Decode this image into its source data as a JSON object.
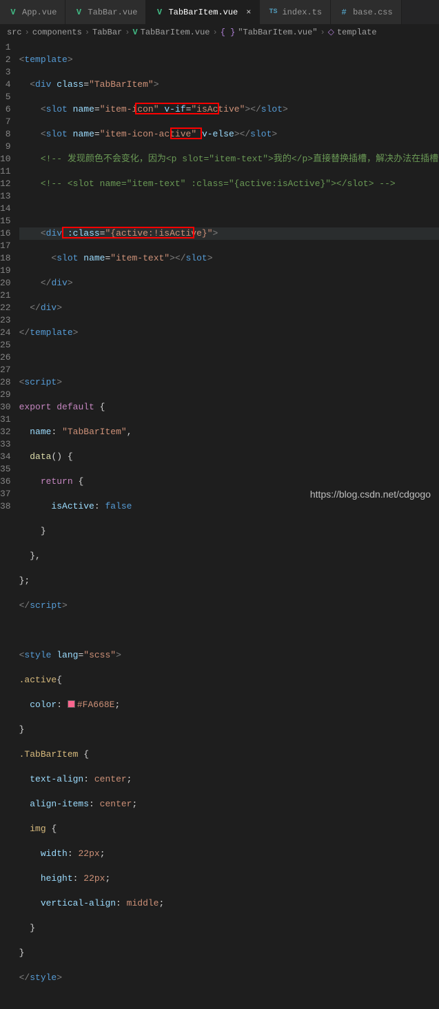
{
  "tabs": [
    {
      "label": "App.vue",
      "icon": "vue",
      "active": false
    },
    {
      "label": "TabBar.vue",
      "icon": "vue",
      "active": false
    },
    {
      "label": "TabBarItem.vue",
      "icon": "vue",
      "active": true
    },
    {
      "label": "index.ts",
      "icon": "ts",
      "active": false
    },
    {
      "label": "base.css",
      "icon": "css",
      "active": false
    }
  ],
  "breadcrumb": {
    "parts": [
      {
        "label": "src"
      },
      {
        "label": "components"
      },
      {
        "label": "TabBar"
      },
      {
        "label": "TabBarItem.vue",
        "icon": "vue"
      },
      {
        "label": "\"TabBarItem.vue\"",
        "icon": "braces"
      },
      {
        "label": "template",
        "icon": "cube"
      }
    ]
  },
  "lineNumbers": [
    "1",
    "2",
    "3",
    "4",
    "5",
    "6",
    "7",
    "8",
    "9",
    "10",
    "11",
    "12",
    "13",
    "14",
    "15",
    "16",
    "17",
    "18",
    "19",
    "20",
    "21",
    "22",
    "23",
    "24",
    "25",
    "26",
    "27",
    "28",
    "29",
    "30",
    "31",
    "32",
    "33",
    "34",
    "35",
    "36",
    "37",
    "38"
  ],
  "code": {
    "l1": "<template>",
    "l2": "  <div class=\"TabBarItem\">",
    "l3a": "    <slot name=\"item-icon\" ",
    "l3b": "v-if=\"isActive\"",
    "l3c": "></slot>",
    "l4a": "    <slot name=\"item-icon-active\" ",
    "l4b": "v-else",
    "l4c": "></slot>",
    "l5": "    <!-- 发现颜色不会变化，因为<p slot=\"item-text\">我的</p>直接替换插槽，解决办法在插槽外边",
    "l6": "    <!-- <slot name=\"item-text\" :class=\"{active:isActive}\"></slot> -->",
    "l7": "",
    "l8a": "    <div ",
    "l8b": ":class=\"{active:!isActive}\"",
    "l8c": ">",
    "l9": "      <slot name=\"item-text\"></slot>",
    "l10": "    </div>",
    "l11": "  </div>",
    "l12": "</template>",
    "l14": "<script>",
    "l15": "export default {",
    "l16": "  name: \"TabBarItem\",",
    "l17": "  data() {",
    "l18": "    return {",
    "l19": "      isActive: false",
    "l20": "    }",
    "l21": "  },",
    "l22": "};",
    "l23": "</script>",
    "l25": "<style lang=\"scss\">",
    "l26": ".active{",
    "l27": "  color: #FA668E;",
    "l28": "}",
    "l29": ".TabBarItem {",
    "l30": "  text-align: center;",
    "l31": "  align-items: center;",
    "l32": "  img {",
    "l33": "    width: 22px;",
    "l34": "    height: 22px;",
    "l35": "    vertical-align: middle;",
    "l36": "  }",
    "l37": "}",
    "l38": "</style>"
  },
  "watermark": "https://blog.csdn.net/cdgogo",
  "chart_data": null
}
